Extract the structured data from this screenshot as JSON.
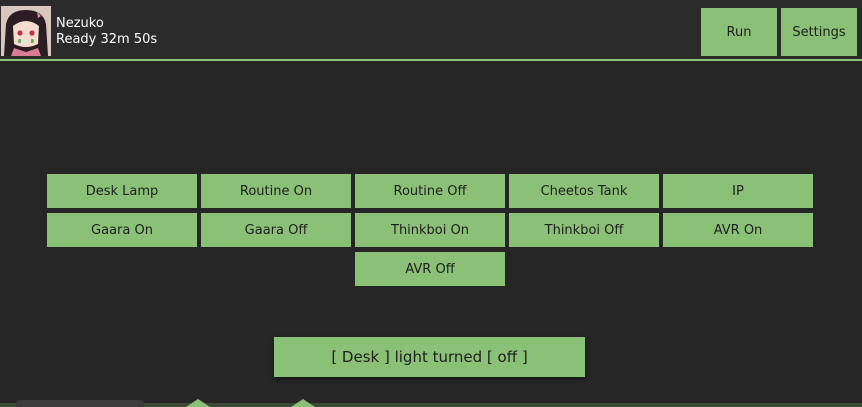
{
  "header": {
    "user_name": "Nezuko",
    "user_status": "Ready 32m 50s",
    "run_label": "Run",
    "settings_label": "Settings"
  },
  "buttons": [
    "Desk Lamp",
    "Routine On",
    "Routine Off",
    "Cheetos Tank",
    "IP",
    "Gaara On",
    "Gaara Off",
    "Thinkboi On",
    "Thinkboi Off",
    "AVR On",
    "AVR Off"
  ],
  "status_message": "[ Desk ] light turned [ off ]",
  "colors": {
    "accent": "#8bc177",
    "background": "#262626",
    "header_bg": "#2b2b2b"
  }
}
